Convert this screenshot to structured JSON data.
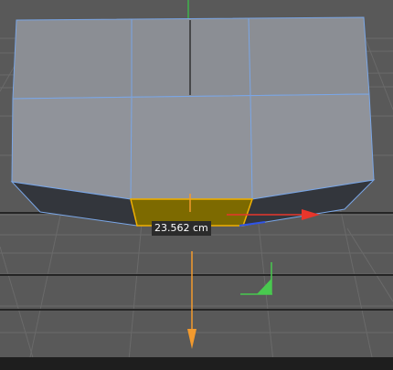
{
  "viewport": {
    "measurement_label": "23.562 cm",
    "colors": {
      "background": "#595959",
      "grid_line": "#6e6e6e",
      "grid_line_major": "#252525",
      "bottom_bar": "#1e1e1e",
      "mesh_face": "#8a8d93",
      "mesh_face_dark": "#33363c",
      "mesh_edge": "#7aa6e6",
      "selected_polygon": "#7d6a00",
      "selected_edge": "#f0b000",
      "x_axis": "#e8362c",
      "y_axis": "#49c94f",
      "z_axis": "#2f54e8",
      "vertical_axis_handle": "#f29a2e"
    },
    "icons": {
      "move_x_handle": "arrow-right-icon",
      "move_y_handle": "arrow-down-icon",
      "plane_handle": "plane-xy-icon",
      "center_handle": "pivot-dot-icon",
      "axis_indicator": "axis-gizmo-icon"
    }
  }
}
